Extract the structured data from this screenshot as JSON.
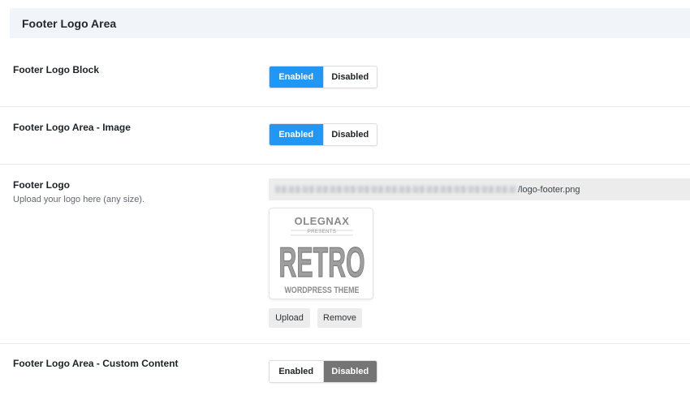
{
  "section": {
    "title": "Footer Logo Area"
  },
  "rows": [
    {
      "label": "Footer Logo Block",
      "enabled_label": "Enabled",
      "disabled_label": "Disabled",
      "state": "enabled"
    },
    {
      "label": "Footer Logo Area - Image",
      "enabled_label": "Enabled",
      "disabled_label": "Disabled",
      "state": "enabled"
    },
    {
      "label": "Footer Logo",
      "description": "Upload your logo here (any size).",
      "url_suffix": "/logo-footer.png",
      "preview": {
        "top": "OLEGNAX",
        "sub": "PRESENTS",
        "main": "RETRO",
        "bottom": "WORDPRESS THEME"
      },
      "upload_label": "Upload",
      "remove_label": "Remove"
    },
    {
      "label": "Footer Logo Area - Custom Content",
      "enabled_label": "Enabled",
      "disabled_label": "Disabled",
      "state": "disabled"
    }
  ],
  "colors": {
    "enabled_active": "#2196f3",
    "disabled_active": "#757575",
    "header_bg": "#f1f5f9"
  }
}
